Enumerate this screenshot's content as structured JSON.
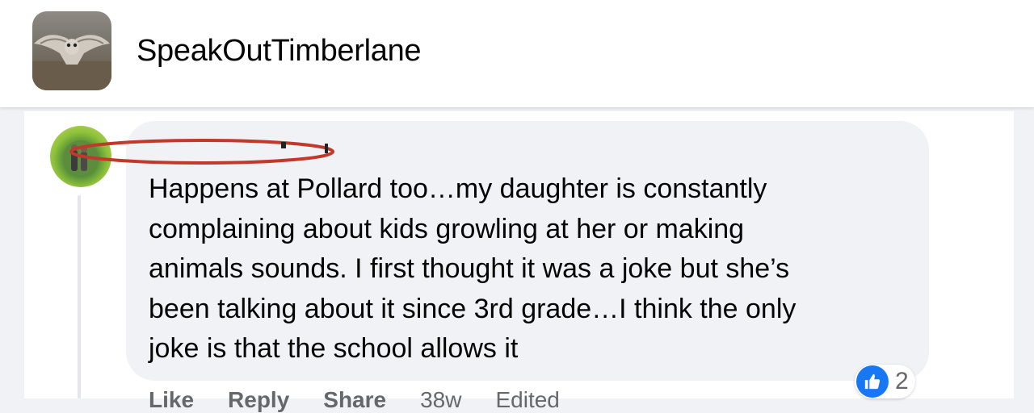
{
  "page": {
    "name": "SpeakOutTimberlane"
  },
  "comment": {
    "author": "",
    "text": "Happens at Pollard too…my daughter is constantly\ncomplaining about kids growling at her or making\nanimals sounds. I first thought it was a joke but she’s\nbeen talking about it since 3rd grade…I think the only\njoke is that the school allows it",
    "reaction_count": "2",
    "actions": {
      "like": "Like",
      "reply": "Reply",
      "share": "Share",
      "time": "38w",
      "edited": "Edited"
    }
  },
  "colors": {
    "accent": "#1877f2",
    "redaction": "#c0392b",
    "bubble": "#f0f2f5",
    "muted": "#65676b"
  },
  "icons": {
    "reaction": "thumbs-up-icon",
    "redaction": "red-ellipse-mark"
  }
}
